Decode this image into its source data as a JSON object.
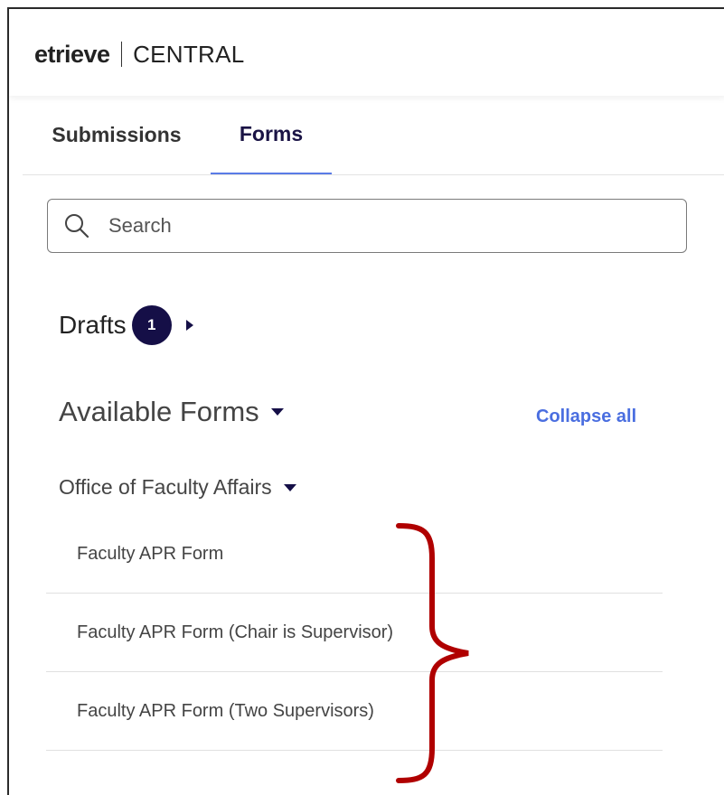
{
  "header": {
    "logo_text": "etrieve",
    "product": "CENTRAL"
  },
  "tabs": [
    {
      "label": "Submissions",
      "active": false
    },
    {
      "label": "Forms",
      "active": true
    }
  ],
  "search": {
    "placeholder": "Search",
    "value": ""
  },
  "drafts": {
    "label": "Drafts",
    "count": "1"
  },
  "available_forms": {
    "label": "Available Forms",
    "collapse_label": "Collapse all",
    "groups": [
      {
        "label": "Office of Faculty Affairs",
        "forms": [
          "Faculty APR Form",
          "Faculty APR Form (Chair is Supervisor)",
          "Faculty APR Form (Two Supervisors)"
        ]
      }
    ]
  },
  "colors": {
    "accent": "#4a6ee0",
    "brand_dark": "#150f47",
    "annotation": "#b00000"
  },
  "icons": [
    "search-icon",
    "caret-right-icon",
    "caret-down-icon",
    "brace-annotation"
  ]
}
